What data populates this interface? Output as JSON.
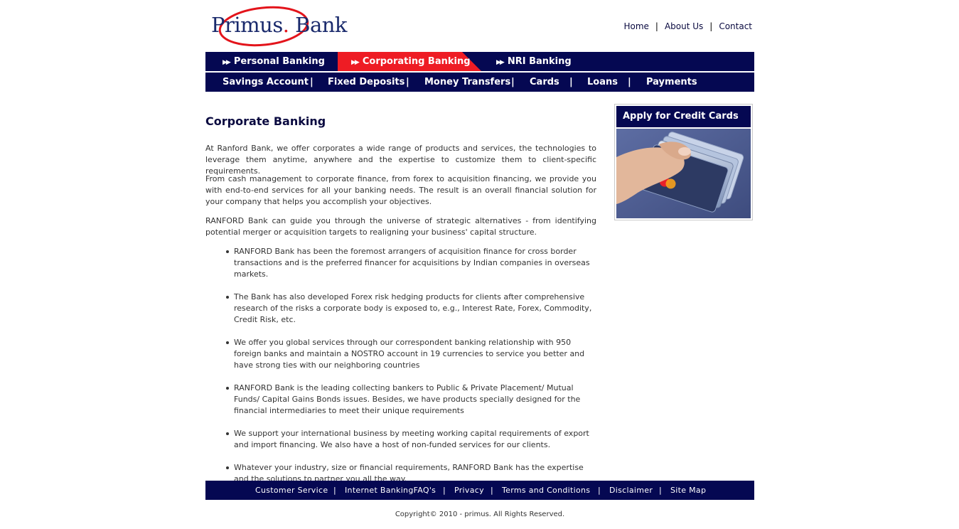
{
  "brand": {
    "name": "Primus",
    "dot": ".",
    "suffix": "Bank",
    "accent_red": "#ee1c24",
    "navy": "#050852"
  },
  "toplinks": [
    "Home",
    "About Us",
    "Contact"
  ],
  "main_tabs": [
    {
      "label": "Personal Banking",
      "active": false,
      "icon": "double-arrow-icon"
    },
    {
      "label": "Corporating Banking",
      "active": true,
      "icon": "double-arrow-icon"
    },
    {
      "label": "NRI Banking",
      "active": false,
      "icon": "double-arrow-icon"
    }
  ],
  "sub_nav": [
    "Savings Account",
    "Fixed Deposits",
    "Money Transfers",
    "Cards",
    "Loans",
    "Payments"
  ],
  "sub_nav_sep": "|",
  "content": {
    "title": "Corporate Banking",
    "paragraphs": [
      "At Ranford Bank, we offer corporates a wide range of products and services, the technologies to leverage them anytime, anywhere and the expertise to customize them to client-specific requirements.",
      "From cash management to corporate finance, from forex to acquisition financing, we provide you with end-to-end services for all your banking needs. The result is an overall financial solution for your company that helps you accomplish your objectives.",
      "RANFORD Bank can guide you through the universe of strategic alternatives - from identifying potential merger or acquisition targets to realigning your business' capital structure."
    ],
    "bullets": [
      "RANFORD Bank has been the foremost arrangers of acquisition finance for cross border transactions and is the preferred financer for acquisitions by Indian companies in overseas markets.",
      "The Bank has also developed Forex risk hedging products for clients after comprehensive research of the risks a corporate body is exposed to, e.g., Interest Rate, Forex, Commodity, Credit Risk, etc.",
      "We offer you global services through our correspondent banking relationship with 950 foreign banks and maintain a NOSTRO account in 19 currencies to service you better and have strong ties with our neighboring countries",
      "RANFORD Bank is the leading collecting bankers to Public & Private Placement/ Mutual Funds/ Capital Gains Bonds issues. Besides, we have products specially designed for the financial intermediaries to meet their unique requirements",
      "We support your international business by meeting working capital requirements of export and import financing. We also have a host of non-funded services for our clients.",
      "Whatever your industry, size or financial requirements, RANFORD Bank has the expertise and the solutions to partner you all the way."
    ]
  },
  "sidebar": {
    "title": "Apply for Credit Cards",
    "image": "credit-cards-in-hand"
  },
  "footer": {
    "links": [
      "Customer Service",
      "Internet BankingFAQ's",
      "Privacy",
      "Terms and Conditions",
      "Disclaimer",
      "Site Map"
    ],
    "copyright": "Copyright© 2010 - primus. All Rights Reserved."
  }
}
